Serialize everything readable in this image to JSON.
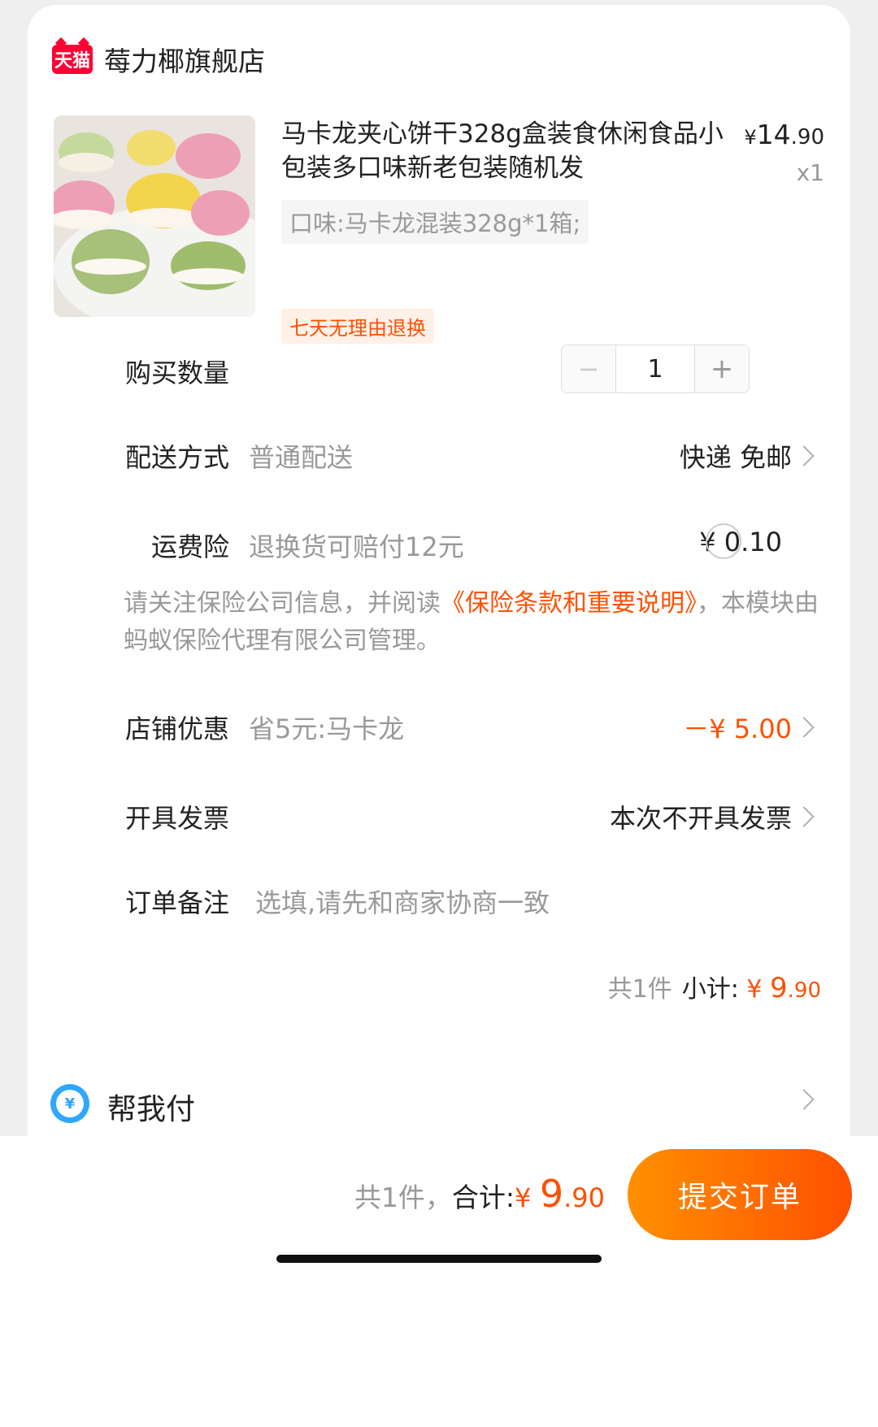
{
  "shop": {
    "logo_text": "天猫",
    "name": "莓力椰旗舰店"
  },
  "product": {
    "image_icon": "macaron-product-photo",
    "title": "马卡龙夹心饼干328g盒装食休闲食品小包装多口味新老包装随机发",
    "price_currency": "¥",
    "price_int": "14",
    "price_dec": ".90",
    "quantity_label": "x1",
    "sku": "口味:马卡龙混装328g*1箱;",
    "tag": "七天无理由退换"
  },
  "rows": {
    "quantity": {
      "label": "购买数量",
      "minus": "−",
      "value": "1",
      "plus": "+"
    },
    "delivery": {
      "label": "配送方式",
      "sub": "普通配送",
      "value": "快递 免邮"
    },
    "insurance": {
      "label": "运费险",
      "sub": "退换货可赔付12元",
      "value": "¥ 0.10"
    },
    "notice": {
      "prefix": "请关注保险公司信息，并阅读",
      "link": "《保险条款和重要说明》",
      "suffix": "，本模块由蚂蚁保险代理有限公司管理。"
    },
    "discount": {
      "label": "店铺优惠",
      "sub": "省5元:马卡龙",
      "value": "－¥ 5.00"
    },
    "invoice": {
      "label": "开具发票",
      "value": "本次不开具发票"
    },
    "remark": {
      "label": "订单备注",
      "placeholder": "选填,请先和商家协商一致"
    }
  },
  "subtotal": {
    "count": "共1件",
    "label": "小计:",
    "currency": "¥",
    "int": "9",
    "dec": ".90"
  },
  "help_pay": {
    "icon": "yuan-coin-icon",
    "icon_text": "¥",
    "label": "帮我付"
  },
  "footer": {
    "count": "共1件，",
    "label": "合计:",
    "currency": "¥",
    "int": "9",
    "dec": ".90",
    "submit": "提交订单"
  },
  "colors": {
    "accent": "#ff5000",
    "tmall_red": "#ff0036",
    "pay_blue": "#2fa6ff"
  }
}
